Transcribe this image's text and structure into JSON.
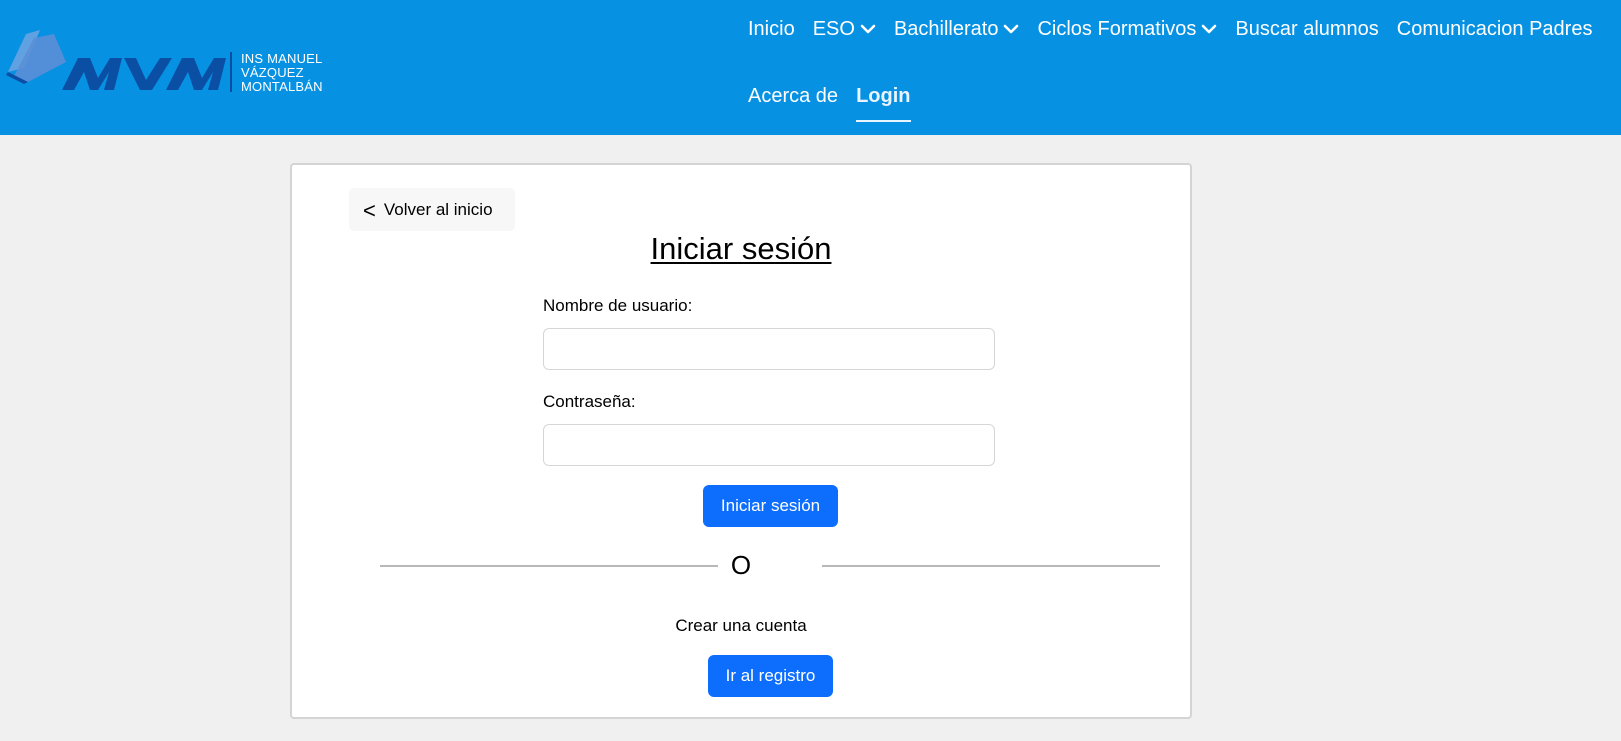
{
  "brand": {
    "logo_text_lines": [
      "INS MANUEL",
      "VÁZQUEZ",
      "MONTALBÁN"
    ],
    "logo_letters": "MVM",
    "colors": {
      "navbar": "#0791e3",
      "logo_dark": "#0a4fa3",
      "logo_light": "#4a87d6"
    }
  },
  "nav": {
    "row1": [
      {
        "label": "Inicio",
        "dropdown": false
      },
      {
        "label": "ESO",
        "dropdown": true
      },
      {
        "label": "Bachillerato",
        "dropdown": true
      },
      {
        "label": "Ciclos Formativos",
        "dropdown": true
      },
      {
        "label": "Buscar alumnos",
        "dropdown": false
      },
      {
        "label": "Comunicacion Padres",
        "dropdown": false
      }
    ],
    "row2": [
      {
        "label": "Acerca de",
        "active": false
      },
      {
        "label": "Login",
        "active": true
      }
    ]
  },
  "login": {
    "back_label": "Volver al inicio",
    "back_icon": "<",
    "title": "Iniciar sesión",
    "username_label": "Nombre de usuario:",
    "username_value": "",
    "password_label": "Contraseña:",
    "password_value": "",
    "submit_label": "Iniciar sesión",
    "divider_text": "O",
    "create_account_text": "Crear una cuenta",
    "register_label": "Ir al registro",
    "button_color": "#0d6efd"
  }
}
